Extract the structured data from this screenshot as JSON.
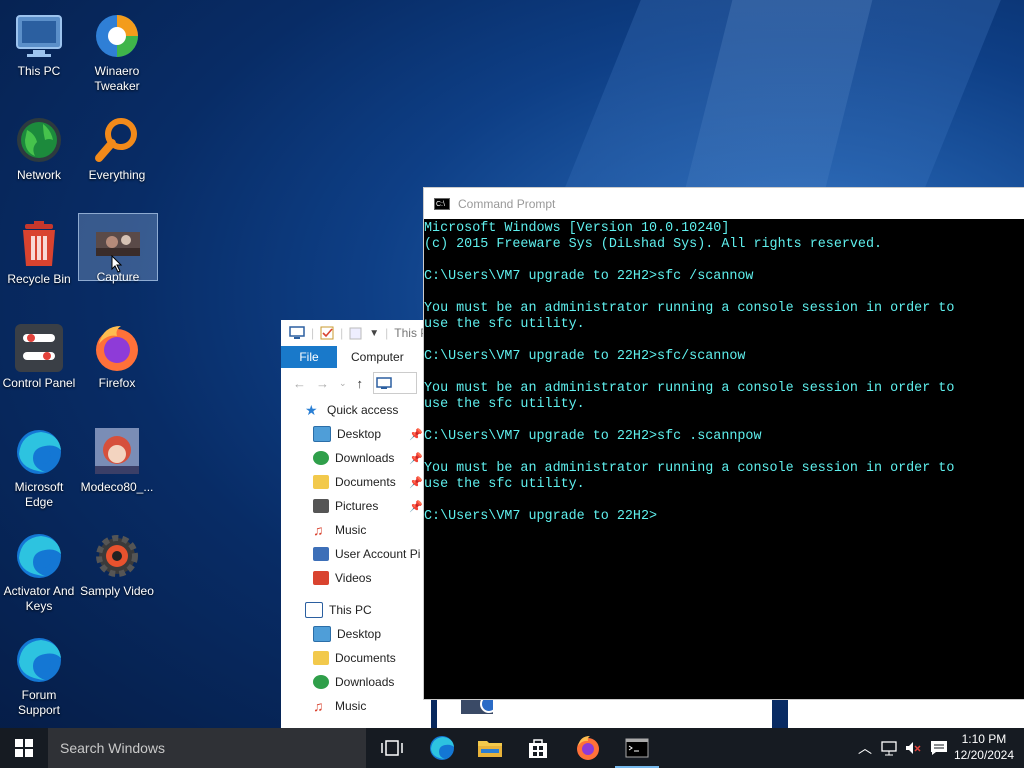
{
  "desktop": {
    "icons": [
      {
        "label": "This PC"
      },
      {
        "label": "Winaero Tweaker"
      },
      {
        "label": "Network"
      },
      {
        "label": "Everything"
      },
      {
        "label": "Recycle Bin"
      },
      {
        "label": "Capture"
      },
      {
        "label": "Control Panel"
      },
      {
        "label": "Firefox"
      },
      {
        "label": "Microsoft Edge"
      },
      {
        "label": "Modeco80_..."
      },
      {
        "label": "Activator And Keys"
      },
      {
        "label": "Samply Video"
      },
      {
        "label": "Forum Support"
      }
    ]
  },
  "explorer": {
    "title": "This P",
    "ribbon": {
      "file": "File",
      "computer": "Computer"
    },
    "tree": [
      {
        "label": "Quick access",
        "icon": "star-icon",
        "pinned": false
      },
      {
        "label": "Desktop",
        "icon": "desktop-folder-icon",
        "pinned": true
      },
      {
        "label": "Downloads",
        "icon": "downloads-icon",
        "pinned": true
      },
      {
        "label": "Documents",
        "icon": "documents-icon",
        "pinned": true
      },
      {
        "label": "Pictures",
        "icon": "pictures-icon",
        "pinned": true
      },
      {
        "label": "Music",
        "icon": "music-icon",
        "pinned": false
      },
      {
        "label": "User Account Pi",
        "icon": "folder-icon",
        "pinned": false
      },
      {
        "label": "Videos",
        "icon": "videos-icon",
        "pinned": false
      },
      {
        "label": "This PC",
        "icon": "computer-icon",
        "pinned": false
      },
      {
        "label": "Desktop",
        "icon": "desktop-folder-icon",
        "pinned": false
      },
      {
        "label": "Documents",
        "icon": "documents-icon",
        "pinned": false
      },
      {
        "label": "Downloads",
        "icon": "downloads-icon",
        "pinned": false
      },
      {
        "label": "Music",
        "icon": "music-icon",
        "pinned": false
      }
    ]
  },
  "cmd": {
    "title": "Command Prompt",
    "lines": [
      "Microsoft Windows [Version 10.0.10240]",
      "(c) 2015 Freeware Sys (DiLshad Sys). All rights reserved.",
      "",
      "C:\\Users\\VM7 upgrade to 22H2>sfc /scannow",
      "",
      "You must be an administrator running a console session in order to",
      "use the sfc utility.",
      "",
      "C:\\Users\\VM7 upgrade to 22H2>sfc/scannow",
      "",
      "You must be an administrator running a console session in order to",
      "use the sfc utility.",
      "",
      "C:\\Users\\VM7 upgrade to 22H2>sfc .scannpow",
      "",
      "You must be an administrator running a console session in order to",
      "use the sfc utility.",
      "",
      "C:\\Users\\VM7 upgrade to 22H2>"
    ],
    "text_color": "#5ff0ee"
  },
  "taskbar": {
    "search_placeholder": "Search Windows",
    "apps": [
      "task-view",
      "edge",
      "file-explorer",
      "store",
      "firefox",
      "command-prompt"
    ],
    "active_app": "command-prompt",
    "time": "1:10 PM",
    "date": "12/20/2024"
  }
}
